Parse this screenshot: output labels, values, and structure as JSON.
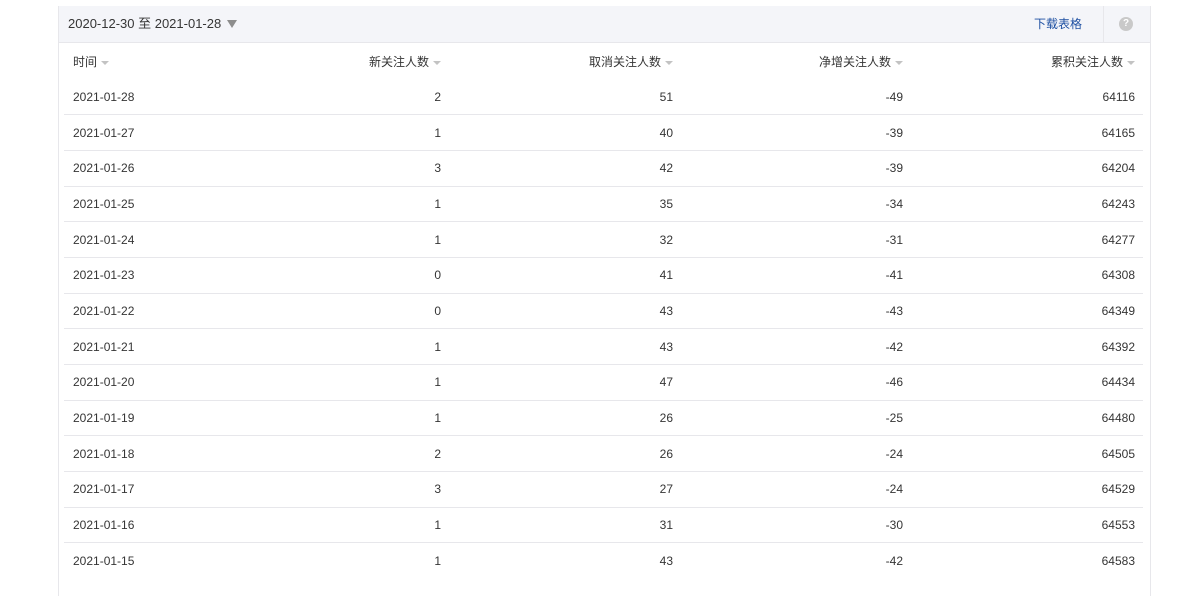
{
  "toolbar": {
    "date_range": "2020-12-30 至 2021-01-28",
    "download_label": "下载表格",
    "help_symbol": "?"
  },
  "table": {
    "headers": [
      "时间",
      "新关注人数",
      "取消关注人数",
      "净增关注人数",
      "累积关注人数"
    ],
    "rows": [
      [
        "2021-01-28",
        "2",
        "51",
        "-49",
        "64116"
      ],
      [
        "2021-01-27",
        "1",
        "40",
        "-39",
        "64165"
      ],
      [
        "2021-01-26",
        "3",
        "42",
        "-39",
        "64204"
      ],
      [
        "2021-01-25",
        "1",
        "35",
        "-34",
        "64243"
      ],
      [
        "2021-01-24",
        "1",
        "32",
        "-31",
        "64277"
      ],
      [
        "2021-01-23",
        "0",
        "41",
        "-41",
        "64308"
      ],
      [
        "2021-01-22",
        "0",
        "43",
        "-43",
        "64349"
      ],
      [
        "2021-01-21",
        "1",
        "43",
        "-42",
        "64392"
      ],
      [
        "2021-01-20",
        "1",
        "47",
        "-46",
        "64434"
      ],
      [
        "2021-01-19",
        "1",
        "26",
        "-25",
        "64480"
      ],
      [
        "2021-01-18",
        "2",
        "26",
        "-24",
        "64505"
      ],
      [
        "2021-01-17",
        "3",
        "27",
        "-24",
        "64529"
      ],
      [
        "2021-01-16",
        "1",
        "31",
        "-30",
        "64553"
      ],
      [
        "2021-01-15",
        "1",
        "43",
        "-42",
        "64583"
      ]
    ]
  },
  "colors": {
    "link": "#1e50a2",
    "toolbar_bg": "#f4f5f9",
    "border": "#e7e7eb",
    "text": "#353535"
  }
}
